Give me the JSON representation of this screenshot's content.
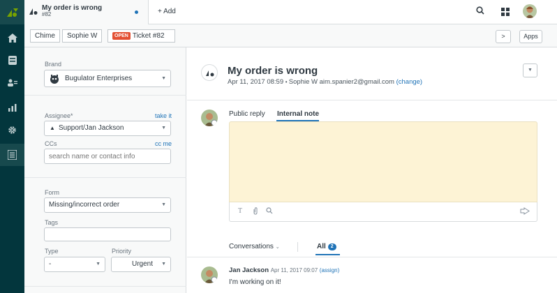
{
  "colors": {
    "rail": "#03363d",
    "accent": "#1f73b7",
    "open_status": "#e34f32",
    "note_bg": "#fdf3d5"
  },
  "tab": {
    "title": "My order is wrong",
    "subtitle": "#82",
    "add_label": "+ Add"
  },
  "breadcrumb": {
    "org": "Chime",
    "requester": "Sophie W",
    "status": "OPEN",
    "ticket": "Ticket #82"
  },
  "toolbar": {
    "next_label": ">",
    "apps_label": "Apps"
  },
  "properties": {
    "brand_label": "Brand",
    "brand_value": "Bugulator Enterprises",
    "assignee_label": "Assignee*",
    "take_it": "take it",
    "assignee_value": "Support/Jan Jackson",
    "ccs_label": "CCs",
    "cc_me": "cc me",
    "ccs_placeholder": "search name or contact info",
    "form_label": "Form",
    "form_value": "Missing/incorrect order",
    "tags_label": "Tags",
    "type_label": "Type",
    "type_value": "-",
    "priority_label": "Priority",
    "priority_value": "Urgent"
  },
  "ticket": {
    "title": "My order is wrong",
    "date": "Apr 11, 2017 08:59",
    "requester": "Sophie W",
    "email": "aim.spanier2@gmail.com",
    "change": "(change)"
  },
  "composer": {
    "public_reply": "Public reply",
    "internal_note": "Internal note"
  },
  "conversations": {
    "label": "Conversations",
    "all_label": "All",
    "all_count": "2"
  },
  "message": {
    "author": "Jan Jackson",
    "date": "Apr 11, 2017 09:07",
    "assign": "(assign)",
    "text": "I'm working on it!"
  }
}
